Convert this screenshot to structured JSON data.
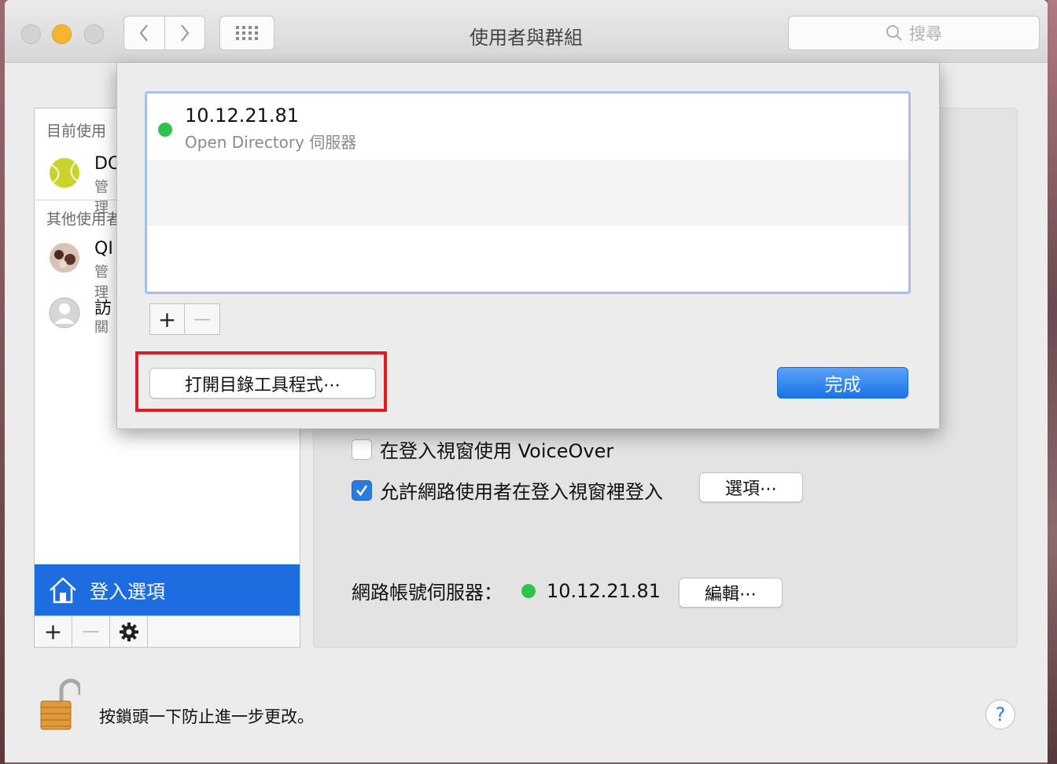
{
  "window": {
    "title": "使用者與群組",
    "search_placeholder": "搜尋"
  },
  "sidebar": {
    "current_header": "目前使用",
    "current_user": {
      "name": "DC",
      "role": "管理"
    },
    "other_header": "其他使用者",
    "other_users": [
      {
        "name": "QI",
        "role": "管理"
      },
      {
        "name": "訪",
        "role": "關"
      }
    ],
    "selected_item": "登入選項",
    "tools": {
      "add": "+",
      "remove": "—"
    }
  },
  "panel": {
    "voiceover_label": "在登入視窗使用 VoiceOver",
    "voiceover_checked": false,
    "network_login_label": "允許網路使用者在登入視窗裡登入",
    "network_login_checked": true,
    "options_button": "選項⋯",
    "network_server_label": "網路帳號伺服器：",
    "network_server_value": "10.12.21.81",
    "edit_button": "編輯⋯"
  },
  "sheet": {
    "servers": [
      {
        "address": "10.12.21.81",
        "type": "Open Directory 伺服器",
        "status_color": "#2ec44b"
      }
    ],
    "add": "+",
    "remove": "—",
    "open_directory_utility_button": "打開目錄工具程式⋯",
    "done_button": "完成"
  },
  "footer": {
    "lock_text": "按鎖頭一下防止進一步更改。",
    "help": "?"
  },
  "colors": {
    "accent": "#1d6ce0",
    "highlight_box": "#e01b22",
    "status_green": "#2ec44b"
  }
}
